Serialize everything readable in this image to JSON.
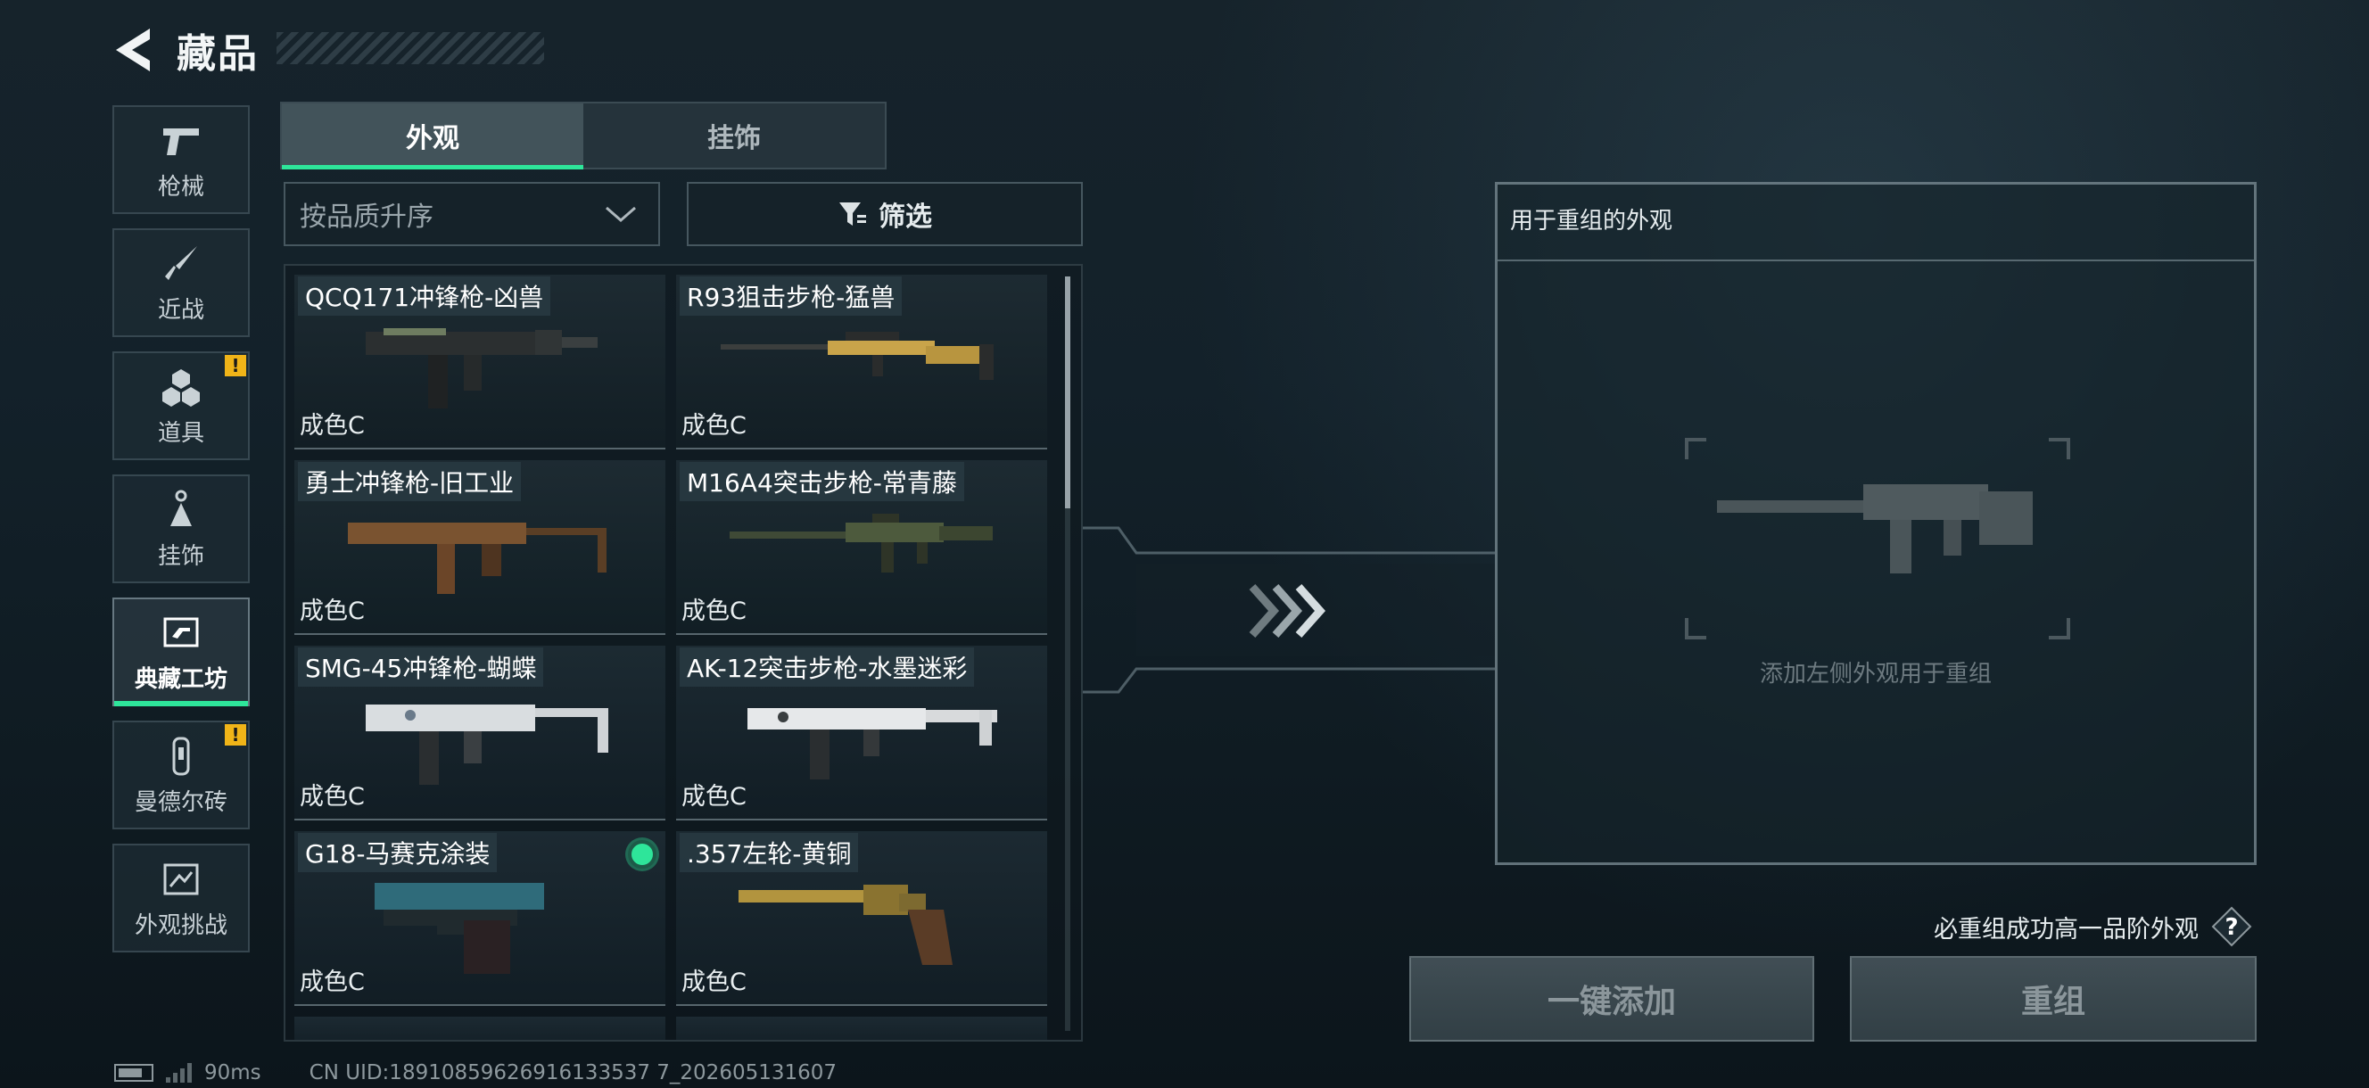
{
  "header": {
    "title": "藏品"
  },
  "sidebar": {
    "items": [
      {
        "label": "枪械",
        "icon": "pistol-icon",
        "active": false,
        "alert": false
      },
      {
        "label": "近战",
        "icon": "knife-icon",
        "active": false,
        "alert": false
      },
      {
        "label": "道具",
        "icon": "cubes-icon",
        "active": false,
        "alert": true
      },
      {
        "label": "挂饰",
        "icon": "charm-icon",
        "active": false,
        "alert": false
      },
      {
        "label": "典藏工坊",
        "icon": "workshop-icon",
        "active": true,
        "alert": false
      },
      {
        "label": "曼德尔砖",
        "icon": "brick-icon",
        "active": false,
        "alert": true
      },
      {
        "label": "外观挑战",
        "icon": "challenge-icon",
        "active": false,
        "alert": false
      }
    ],
    "alert_mark": "!"
  },
  "tabs": [
    {
      "label": "外观",
      "active": true
    },
    {
      "label": "挂饰",
      "active": false
    }
  ],
  "sort": {
    "value": "按品质升序"
  },
  "filter": {
    "label": "筛选"
  },
  "skins": [
    {
      "name": "QCQ171冲锋枪-凶兽",
      "grade": "成色C",
      "selected": false
    },
    {
      "name": "R93狙击步枪-猛兽",
      "grade": "成色C",
      "selected": false
    },
    {
      "name": "勇士冲锋枪-旧工业",
      "grade": "成色C",
      "selected": false
    },
    {
      "name": "M16A4突击步枪-常青藤",
      "grade": "成色C",
      "selected": false
    },
    {
      "name": "SMG-45冲锋枪-蝴蝶",
      "grade": "成色C",
      "selected": false
    },
    {
      "name": "AK-12突击步枪-水墨迷彩",
      "grade": "成色C",
      "selected": false
    },
    {
      "name": "G18-马赛克涂装",
      "grade": "成色C",
      "selected": true
    },
    {
      "name": ".357左轮-黄铜",
      "grade": "成色C",
      "selected": false
    }
  ],
  "recombine": {
    "title": "用于重组的外观",
    "empty_hint": "添加左侧外观用于重组"
  },
  "guarantee": {
    "text": "必重组成功高一品阶外观",
    "help": "?"
  },
  "buttons": {
    "add_all": "一键添加",
    "recombine": "重组"
  },
  "footer": {
    "ping": "90ms",
    "uid": "CN UID:18910859626916133537 7_202605131607"
  },
  "colors": {
    "accent": "#2ee59a",
    "alert": "#f0b418"
  }
}
